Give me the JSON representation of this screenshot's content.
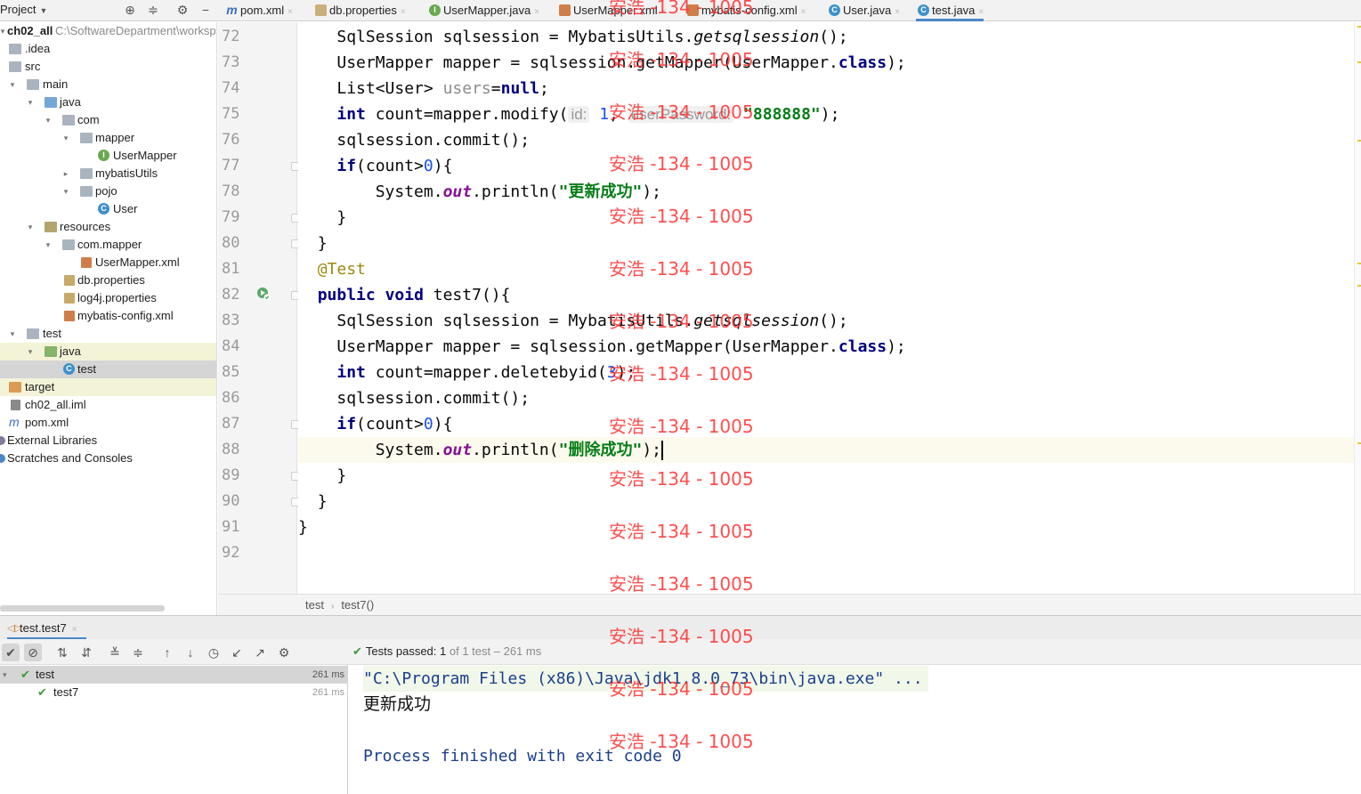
{
  "topbar": {
    "project_label": "Project",
    "tabs": [
      {
        "label": "pom.xml",
        "icon": "m"
      },
      {
        "label": "db.properties",
        "icon": "props"
      },
      {
        "label": "UserMapper.java",
        "icon": "iface"
      },
      {
        "label": "UserMapper.xml",
        "icon": "xml"
      },
      {
        "label": "mybatis-config.xml",
        "icon": "xml"
      },
      {
        "label": "User.java",
        "icon": "class"
      },
      {
        "label": "test.java",
        "icon": "class",
        "active": true
      }
    ],
    "close_glyph": "×"
  },
  "project_tree": {
    "root_name": "ch02_all",
    "root_path": "C:\\SoftwareDepartment\\worksp",
    "items": [
      {
        "label": ".idea"
      },
      {
        "label": "src"
      },
      {
        "label": "main"
      },
      {
        "label": "java"
      },
      {
        "label": "com"
      },
      {
        "label": "mapper"
      },
      {
        "label": "UserMapper"
      },
      {
        "label": "mybatisUtils"
      },
      {
        "label": "pojo"
      },
      {
        "label": "User"
      },
      {
        "label": "resources"
      },
      {
        "label": "com.mapper"
      },
      {
        "label": "UserMapper.xml"
      },
      {
        "label": "db.properties"
      },
      {
        "label": "log4j.properties"
      },
      {
        "label": "mybatis-config.xml"
      },
      {
        "label": "test"
      },
      {
        "label": "java"
      },
      {
        "label": "test"
      },
      {
        "label": "target"
      },
      {
        "label": "ch02_all.iml"
      },
      {
        "label": "pom.xml"
      },
      {
        "label": "External Libraries"
      },
      {
        "label": "Scratches and Consoles"
      }
    ]
  },
  "editor": {
    "line_numbers": [
      "72",
      "73",
      "74",
      "75",
      "76",
      "77",
      "78",
      "79",
      "80",
      "81",
      "82",
      "83",
      "84",
      "85",
      "86",
      "87",
      "88",
      "89",
      "90",
      "91",
      "92"
    ],
    "code": {
      "l72a": "SqlSession sqlsession = MybatisUtils.",
      "l72b": "getsqlsession",
      "l72c": "();",
      "l73a": "UserMapper mapper = sqlsession.getMapper(UserMapper.",
      "l73b": "class",
      "l73c": ");",
      "l74a": "List<User> ",
      "l74b": "users",
      "l74c": "=",
      "l74d": "null",
      "l74e": ";",
      "l75a": "int",
      "l75b": " count=mapper.modify(",
      "l75c": "id:",
      "l75d": "1",
      "l75e": ",",
      "l75f": "userPassword:",
      "l75g": "\"888888\"",
      "l75h": ");",
      "l76a": "sqlsession.commit();",
      "l77a": "if",
      "l77b": "(count>",
      "l77c": "0",
      "l77d": "){",
      "l78a": "System.",
      "l78b": "out",
      "l78c": ".println(",
      "l78d": "\"更新成功\"",
      "l78e": ");",
      "l79a": "}",
      "l80a": "}",
      "l81a": "@Test",
      "l82a": "public",
      "l82b": " ",
      "l82c": "void",
      "l82d": " test7(){",
      "l83a": "SqlSession sqlsession = MybatisUtils.",
      "l83b": "getsqlsession",
      "l83c": "();",
      "l84a": "UserMapper mapper = sqlsession.getMapper(UserMapper.",
      "l84b": "class",
      "l84c": ");",
      "l85a": "int",
      "l85b": " count=mapper.deletebyid(",
      "l85c": "3",
      "l85d": ");",
      "l86a": "sqlsession.commit();",
      "l87a": "if",
      "l87b": "(count>",
      "l87c": "0",
      "l87d": "){",
      "l88a": "System.",
      "l88b": "out",
      "l88c": ".println(",
      "l88d": "\"删除成功\"",
      "l88e": ");",
      "l89a": "}",
      "l90a": "}",
      "l91a": "}"
    }
  },
  "breadcrumb": {
    "class_name": "test",
    "method_name": "test7()"
  },
  "run_panel": {
    "tab_label": "test.test7",
    "status_prefix": "Tests passed:",
    "status_count": "1",
    "status_suffix": "of 1 test – 261 ms",
    "test_tree": [
      {
        "label": "test",
        "time": "261 ms"
      },
      {
        "label": "test7",
        "time": "261 ms"
      }
    ],
    "console": {
      "command": "\"C:\\Program Files (x86)\\Java\\jdk1.8.0_73\\bin\\java.exe\" ...",
      "output": "更新成功",
      "exit": "Process finished with exit code 0"
    }
  },
  "watermark": {
    "text": "安浩 -134 - 1005"
  },
  "colors": {
    "accent": "#4a88c7",
    "keyword": "#000080",
    "string": "#067d17",
    "number": "#1750eb",
    "annotation": "#9e880d",
    "watermark": "#ff3030",
    "pass": "#3c9a3c"
  }
}
